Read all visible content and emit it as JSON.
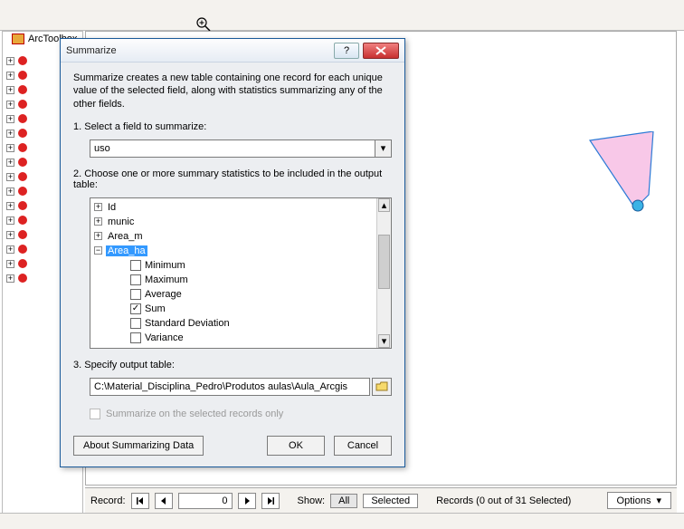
{
  "toc": {
    "title": "ArcToolbox",
    "item_count": 16
  },
  "dialog": {
    "title": "Summarize",
    "intro": "Summarize creates a new table containing one record for each unique value of the selected field, along with statistics summarizing any of the other fields.",
    "step1_label": "1.  Select a field to summarize:",
    "field_value": "uso",
    "step2_label": "2.  Choose one or more summary statistics to be included in the output table:",
    "fields": [
      {
        "name": "Id",
        "expanded": false
      },
      {
        "name": "munic",
        "expanded": false
      },
      {
        "name": "Area_m",
        "expanded": false
      },
      {
        "name": "Area_ha",
        "expanded": true,
        "selected": true
      }
    ],
    "stats": [
      {
        "label": "Minimum",
        "checked": false
      },
      {
        "label": "Maximum",
        "checked": false
      },
      {
        "label": "Average",
        "checked": false
      },
      {
        "label": "Sum",
        "checked": true
      },
      {
        "label": "Standard Deviation",
        "checked": false
      },
      {
        "label": "Variance",
        "checked": false
      }
    ],
    "step3_label": "3.  Specify output table:",
    "output_path": "C:\\Material_Disciplina_Pedro\\Produtos aulas\\Aula_Arcgis",
    "selected_only_label": "Summarize on the selected records only",
    "about_btn": "About Summarizing Data",
    "ok_btn": "OK",
    "cancel_btn": "Cancel"
  },
  "record_bar": {
    "label": "Record:",
    "value": "0",
    "show_label": "Show:",
    "all_btn": "All",
    "selected_btn": "Selected",
    "status": "Records (0 out of 31 Selected)",
    "options_btn": "Options"
  }
}
